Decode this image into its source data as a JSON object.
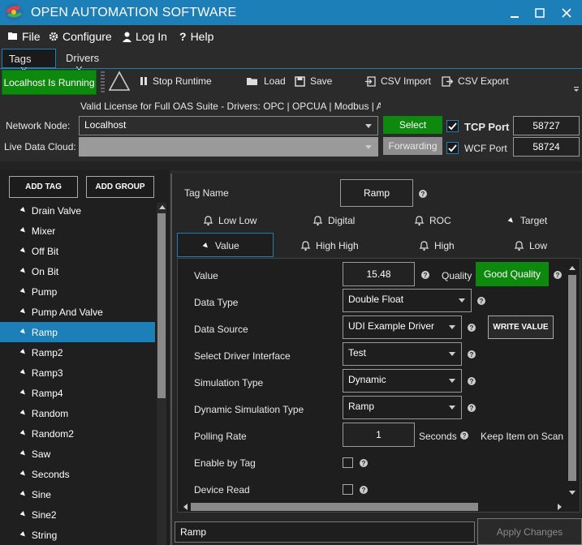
{
  "app": {
    "title": "OPEN AUTOMATION SOFTWARE"
  },
  "menu": {
    "file": "File",
    "configure": "Configure",
    "login": "Log In",
    "help": "Help"
  },
  "tabs": [
    {
      "label": "Tags",
      "close": "X"
    },
    {
      "label": "Drivers",
      "close": "X"
    }
  ],
  "toolbar": {
    "status": "Localhost Is Running",
    "stop": "Stop Runtime",
    "load": "Load",
    "save": "Save",
    "csv_import": "CSV Import",
    "csv_export": "CSV Export",
    "license": "Valid License for Full OAS Suite - Drivers: OPC | OPCUA | Modbus | ABLogix"
  },
  "network": {
    "node_label": "Network Node:",
    "node_value": "Localhost",
    "select_label": "Select",
    "cloud_label": "Live Data Cloud:",
    "cloud_value": "",
    "forwarding_label": "Forwarding",
    "tcp_label": "TCP Port",
    "tcp_value": "58727",
    "tcp_checked": true,
    "wcf_label": "WCF Port",
    "wcf_value": "58724",
    "wcf_checked": true
  },
  "left": {
    "add_tag": "ADD TAG",
    "add_group": "ADD GROUP",
    "tags": [
      "Drain Valve",
      "Mixer",
      "Off Bit",
      "On Bit",
      "Pump",
      "Pump And Valve",
      "Ramp",
      "Ramp2",
      "Ramp3",
      "Ramp4",
      "Random",
      "Random2",
      "Saw",
      "Seconds",
      "Sine",
      "Sine2",
      "String"
    ],
    "selected_index": 6
  },
  "detail": {
    "tag_name_label": "Tag Name",
    "tag_name_value": "Ramp",
    "tabs_row1": [
      "Low Low",
      "Digital",
      "ROC",
      "Target"
    ],
    "tabs_row2": [
      "Value",
      "High High",
      "High",
      "Low"
    ],
    "active_tab": "Value",
    "value_label": "Value",
    "value": "15.48",
    "quality_label": "Quality",
    "quality_value": "Good Quality",
    "data_type_label": "Data Type",
    "data_type": "Double Float",
    "data_source_label": "Data Source",
    "data_source": "UDI Example Driver",
    "write_value": "WRITE VALUE",
    "driver_interface_label": "Select Driver Interface",
    "driver_interface": "Test",
    "sim_type_label": "Simulation Type",
    "sim_type": "Dynamic",
    "dyn_sim_label": "Dynamic Simulation Type",
    "dyn_sim": "Ramp",
    "polling_label": "Polling Rate",
    "polling_value": "1",
    "seconds_label": "Seconds",
    "keep_on_scan": "Keep Item on Scan",
    "enable_by_tag_label": "Enable by Tag",
    "device_read_label": "Device Read"
  },
  "footer": {
    "name_value": "Ramp",
    "apply_label": "Apply Changes"
  },
  "colors": {
    "accent": "#1c7fb8",
    "green": "#0d8a0d"
  }
}
